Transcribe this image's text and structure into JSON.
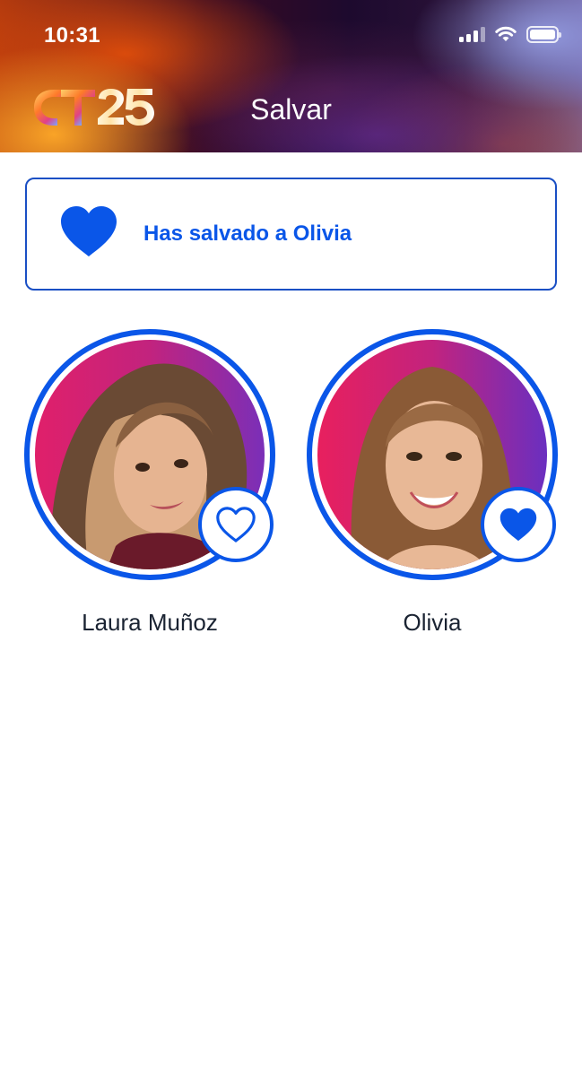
{
  "status_bar": {
    "time": "10:31",
    "signal_icon": "cellular-signal-icon",
    "wifi_icon": "wifi-icon",
    "battery_icon": "battery-icon"
  },
  "header": {
    "logo_text": "OT25",
    "title": "Salvar"
  },
  "banner": {
    "icon": "heart-filled-icon",
    "message": "Has salvado a Olivia"
  },
  "candidates": [
    {
      "name": "Laura Muñoz",
      "saved": false,
      "icon": "heart-outline-icon"
    },
    {
      "name": "Olivia",
      "saved": true,
      "icon": "heart-filled-icon"
    }
  ],
  "colors": {
    "accent": "#0A56E8",
    "border": "#1A4FC4",
    "text_dark": "#1A2332"
  }
}
